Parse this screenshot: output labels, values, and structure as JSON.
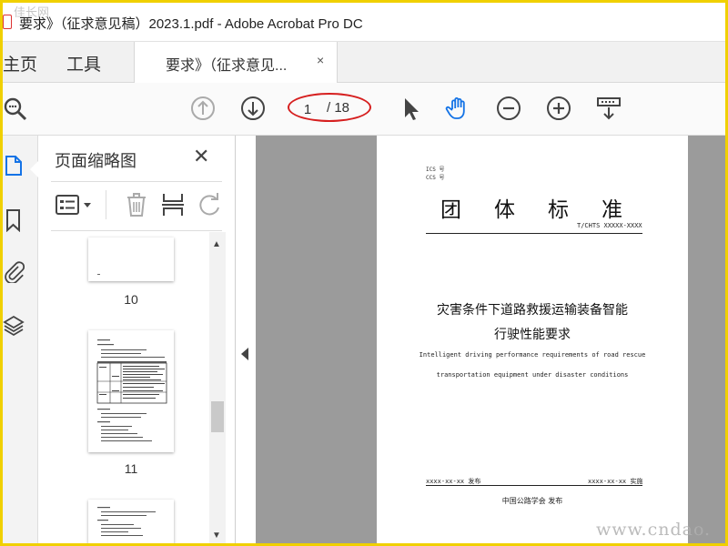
{
  "window": {
    "title": "要求》（征求意见稿）2023.1.pdf - Adobe Acrobat Pro DC",
    "watermark_top": "佳长网"
  },
  "tabs": {
    "home_label": "主页",
    "tools_label": "工具",
    "doc_label": "要求》（征求意见...",
    "close_glyph": "×"
  },
  "toolbar": {
    "page_current": "1",
    "page_total": "/ 18",
    "icons": [
      "search-icon",
      "prev-page-icon",
      "next-page-icon",
      "select-arrow-icon",
      "hand-tool-icon",
      "zoom-out-icon",
      "zoom-in-icon",
      "scroll-mode-icon"
    ],
    "accent": "#1473e6",
    "highlight_color": "#d61f1f"
  },
  "left_rail": {
    "icons": [
      "page-thumbnails-icon",
      "bookmarks-icon",
      "attachments-icon",
      "layers-icon"
    ]
  },
  "thumbnail_panel": {
    "title": "页面缩略图",
    "close_glyph": "✕",
    "tools": [
      "options-menu-icon",
      "delete-page-icon",
      "insert-page-icon",
      "rotate-icon"
    ],
    "pages": [
      {
        "number": "10"
      },
      {
        "number": "11"
      }
    ]
  },
  "document_page": {
    "ics": "ICS 号",
    "ccs": "CCS 号",
    "heading": "团体标准",
    "code": "T/CHTS XXXXX-XXXX",
    "title_cn_line1": "灾害条件下道路救援运输装备智能",
    "title_cn_line2": "行驶性能要求",
    "title_en_line1": "Intelligent driving performance requirements of road rescue",
    "title_en_line2": "transportation equipment under disaster conditions",
    "publish_date": "xxxx-xx-xx 发布",
    "implement_date": "xxxx-xx-xx 实施",
    "issuer": "中国公路学会 发布"
  },
  "watermark_bottom": "www.cndao."
}
